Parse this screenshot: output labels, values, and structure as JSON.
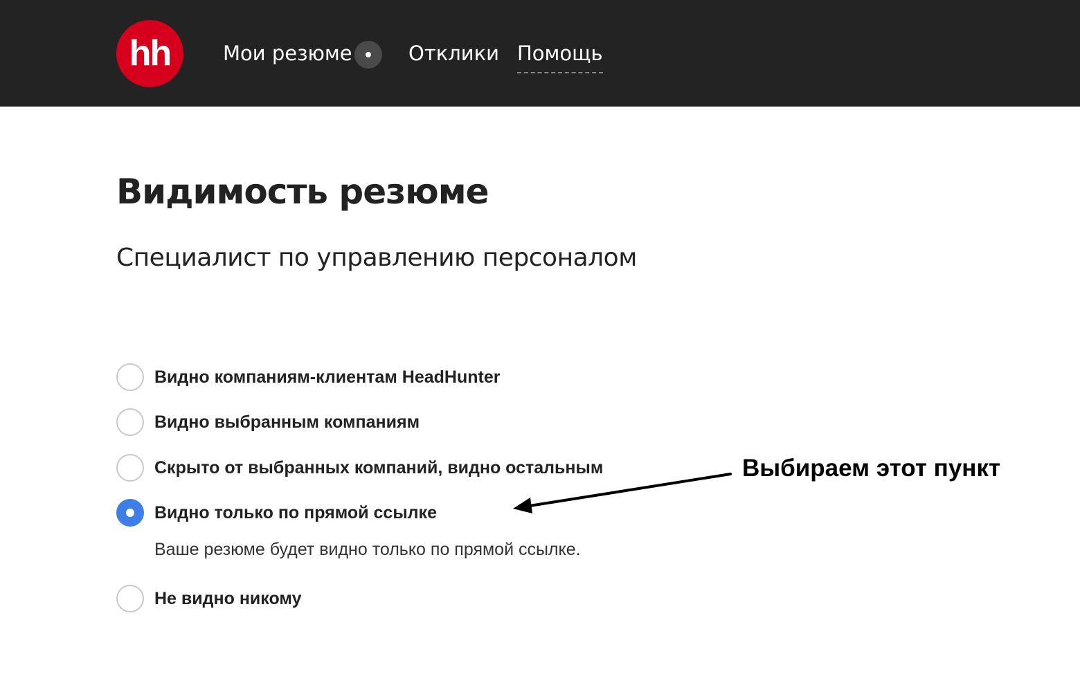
{
  "colors": {
    "header_bg": "#232323",
    "logo_red": "#d6001c",
    "radio_selected": "#3d7fe6",
    "radio_border": "#c9c9c9",
    "text_dark": "#222222"
  },
  "header": {
    "logo_text": "hh",
    "nav": {
      "resumes": "Мои резюме",
      "responses": "Отклики",
      "help": "Помощь"
    }
  },
  "main": {
    "title": "Видимость резюме",
    "resume_name": "Специалист по управлению персоналом",
    "visibility_options": [
      {
        "label": "Видно компаниям-клиентам HeadHunter",
        "selected": false
      },
      {
        "label": "Видно выбранным компаниям",
        "selected": false
      },
      {
        "label": "Скрыто от выбранных компаний, видно остальным",
        "selected": false
      },
      {
        "label": "Видно только по прямой ссылке",
        "selected": true
      },
      {
        "label": "Не видно никому",
        "selected": false
      }
    ],
    "selected_description": "Ваше резюме будет видно только по прямой ссылке."
  },
  "annotation": {
    "text": "Выбираем этот пункт"
  }
}
